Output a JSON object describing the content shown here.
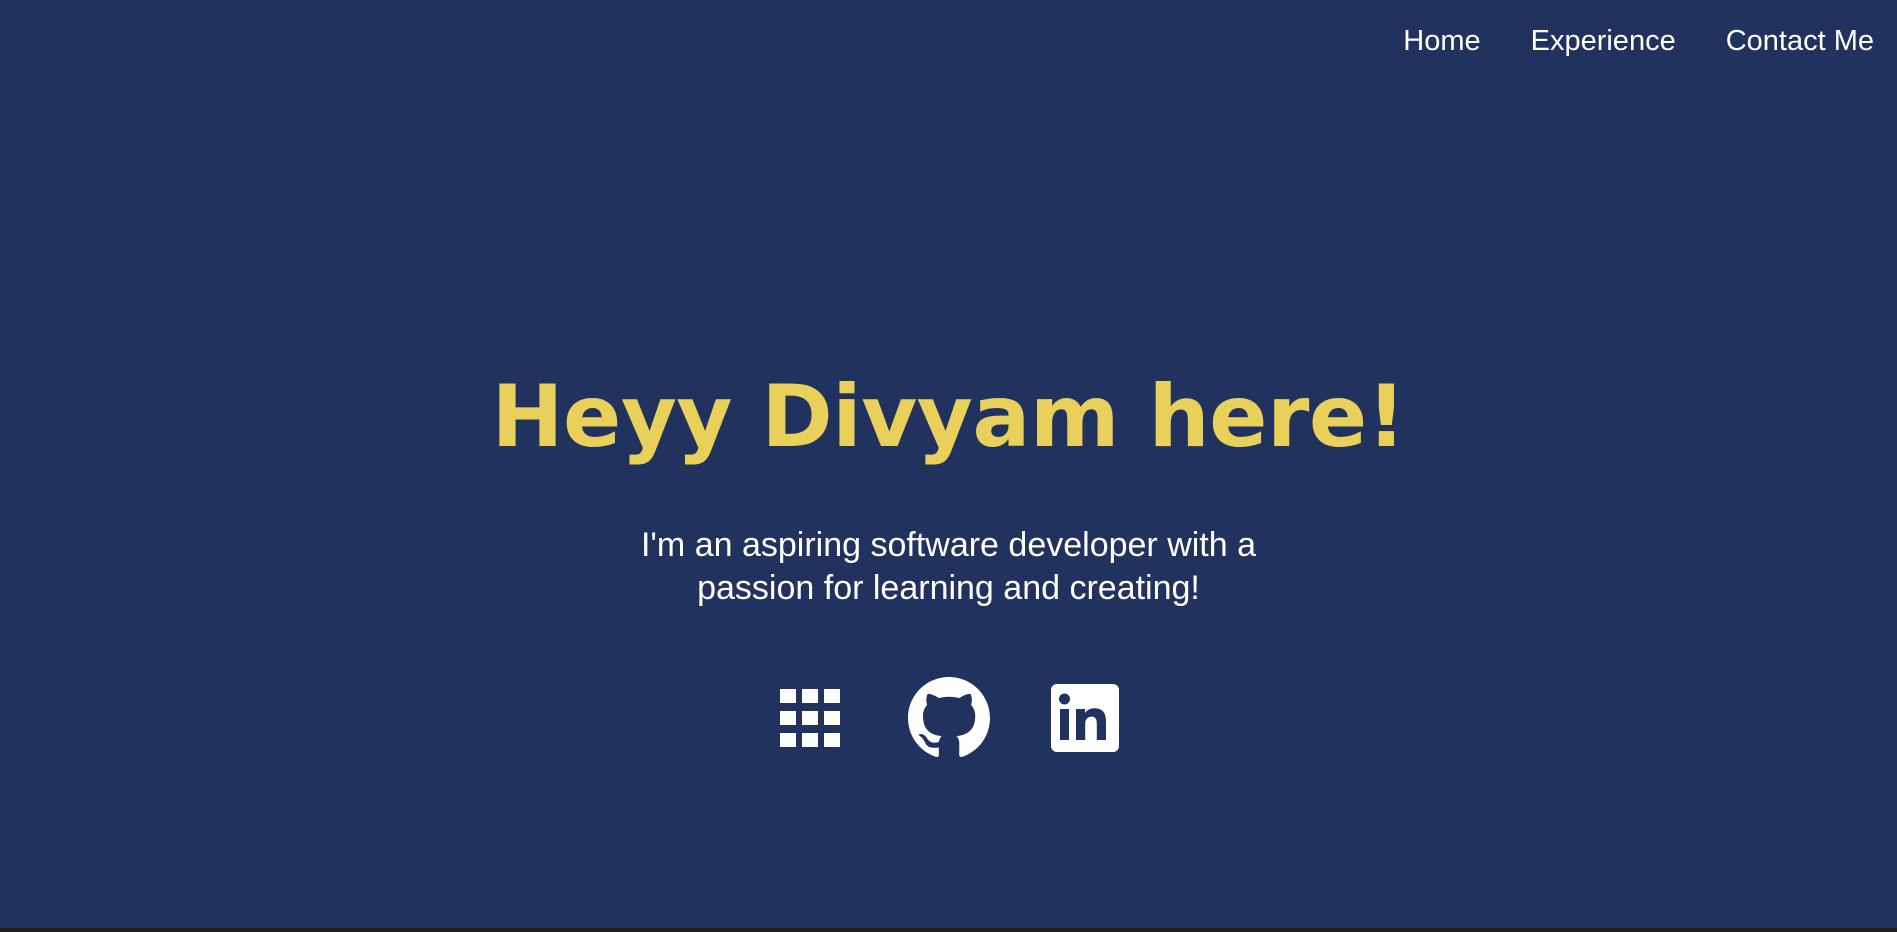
{
  "nav": {
    "items": [
      {
        "label": "Home"
      },
      {
        "label": "Experience"
      },
      {
        "label": "Contact Me"
      }
    ]
  },
  "hero": {
    "title": "Heyy Divyam here!",
    "subtitle": "I'm an aspiring software developer with a passion for learning and creating!"
  },
  "socials": [
    {
      "icon": "apps-grid-icon"
    },
    {
      "icon": "github-icon"
    },
    {
      "icon": "linkedin-icon"
    }
  ],
  "colors": {
    "background": "#22325e",
    "accent": "#e8d05a",
    "text": "#ffffff"
  }
}
